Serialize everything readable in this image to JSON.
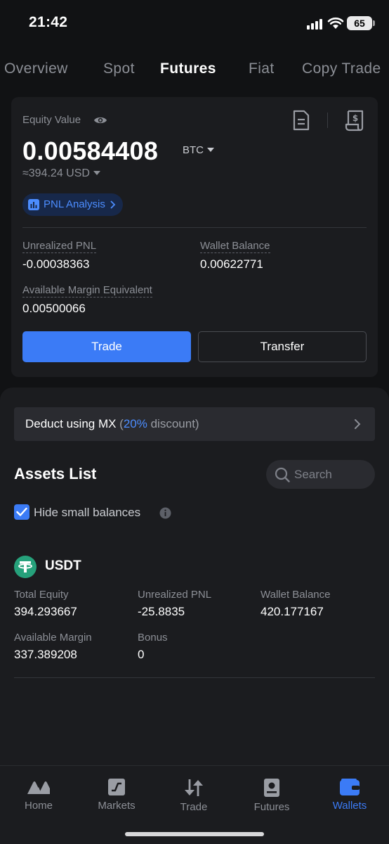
{
  "status_bar": {
    "time": "21:42",
    "battery": "65"
  },
  "top_tabs": [
    {
      "label": "Overview",
      "active": false
    },
    {
      "label": "Spot",
      "active": false
    },
    {
      "label": "Futures",
      "active": true
    },
    {
      "label": "Fiat",
      "active": false
    },
    {
      "label": "Copy Trade",
      "active": false
    }
  ],
  "equity_card": {
    "label": "Equity Value",
    "value": "0.00584408",
    "unit": "BTC",
    "usd_value": "≈394.24 USD",
    "pnl_button": "PNL Analysis",
    "stats": {
      "unrealized_pnl_label": "Unrealized PNL",
      "unrealized_pnl_value": "-0.00038363",
      "wallet_balance_label": "Wallet Balance",
      "wallet_balance_value": "0.00622771",
      "available_margin_label": "Available Margin Equivalent",
      "available_margin_value": "0.00500066"
    },
    "trade_button": "Trade",
    "transfer_button": "Transfer"
  },
  "deduct_banner": {
    "prefix": "Deduct using MX",
    "open_paren": " (",
    "discount": "20%",
    "suffix": " discount)"
  },
  "assets": {
    "title": "Assets List",
    "search_placeholder": "Search",
    "hide_small_label": "Hide small balances",
    "hide_small_checked": true,
    "items": [
      {
        "symbol": "USDT",
        "total_equity_label": "Total Equity",
        "total_equity": "394.293667",
        "unrealized_pnl_label": "Unrealized PNL",
        "unrealized_pnl": "-25.8835",
        "wallet_balance_label": "Wallet Balance",
        "wallet_balance": "420.177167",
        "available_margin_label": "Available Margin",
        "available_margin": "337.389208",
        "bonus_label": "Bonus",
        "bonus": "0"
      }
    ]
  },
  "bottom_nav": [
    {
      "label": "Home",
      "icon": "home-icon",
      "active": false
    },
    {
      "label": "Markets",
      "icon": "markets-icon",
      "active": false
    },
    {
      "label": "Trade",
      "icon": "trade-icon",
      "active": false
    },
    {
      "label": "Futures",
      "icon": "futures-icon",
      "active": false
    },
    {
      "label": "Wallets",
      "icon": "wallet-icon",
      "active": true
    }
  ],
  "colors": {
    "accent": "#3b7bf6",
    "background": "#111214",
    "card": "#1b1c1f",
    "usdt": "#26a17b"
  }
}
